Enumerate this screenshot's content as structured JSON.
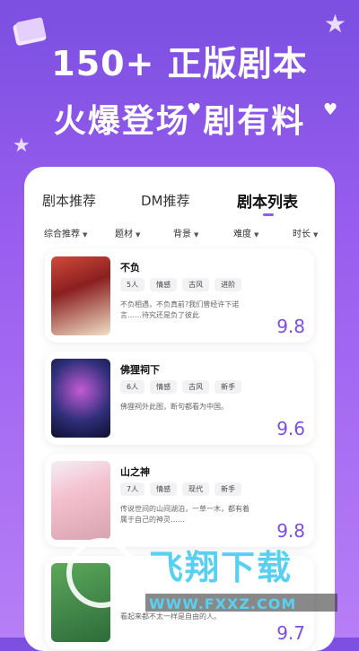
{
  "header": {
    "line1": "150+ 正版剧本",
    "line2": "火爆登场 剧有料"
  },
  "tabs": [
    {
      "label": "剧本推荐"
    },
    {
      "label": "DM推荐"
    },
    {
      "label": "剧本列表",
      "active": true
    }
  ],
  "filters": [
    {
      "label": "综合推荐"
    },
    {
      "label": "题材"
    },
    {
      "label": "背景"
    },
    {
      "label": "难度"
    },
    {
      "label": "时长"
    }
  ],
  "items": [
    {
      "title": "不负",
      "tags": [
        "5人",
        "情感",
        "古风",
        "进阶"
      ],
      "desc": "不负相遇，不负真前?我们曾经许下诺言……待究还是负了彼此",
      "score": "9.8"
    },
    {
      "title": "佛狸祠下",
      "tags": [
        "6人",
        "情感",
        "古风",
        "新手"
      ],
      "desc": "佛狸祠外此图，断句都看为中国。",
      "score": "9.6"
    },
    {
      "title": "山之神",
      "tags": [
        "7人",
        "情感",
        "现代",
        "新手"
      ],
      "desc": "传说世间的山间湖泊，一草一木，都有着属于自己的神灵……",
      "score": "9.8"
    },
    {
      "title": "",
      "tags": [],
      "desc": "看起来都不太一样是自由的人。",
      "score": "9.7"
    }
  ],
  "watermark": {
    "text": "飞翔下载",
    "url": "WWW.FXXZ.COM"
  },
  "colors": {
    "accent": "#7b4fe0",
    "background_top": "#7b4fe0",
    "background_bottom": "#b77ef6"
  }
}
